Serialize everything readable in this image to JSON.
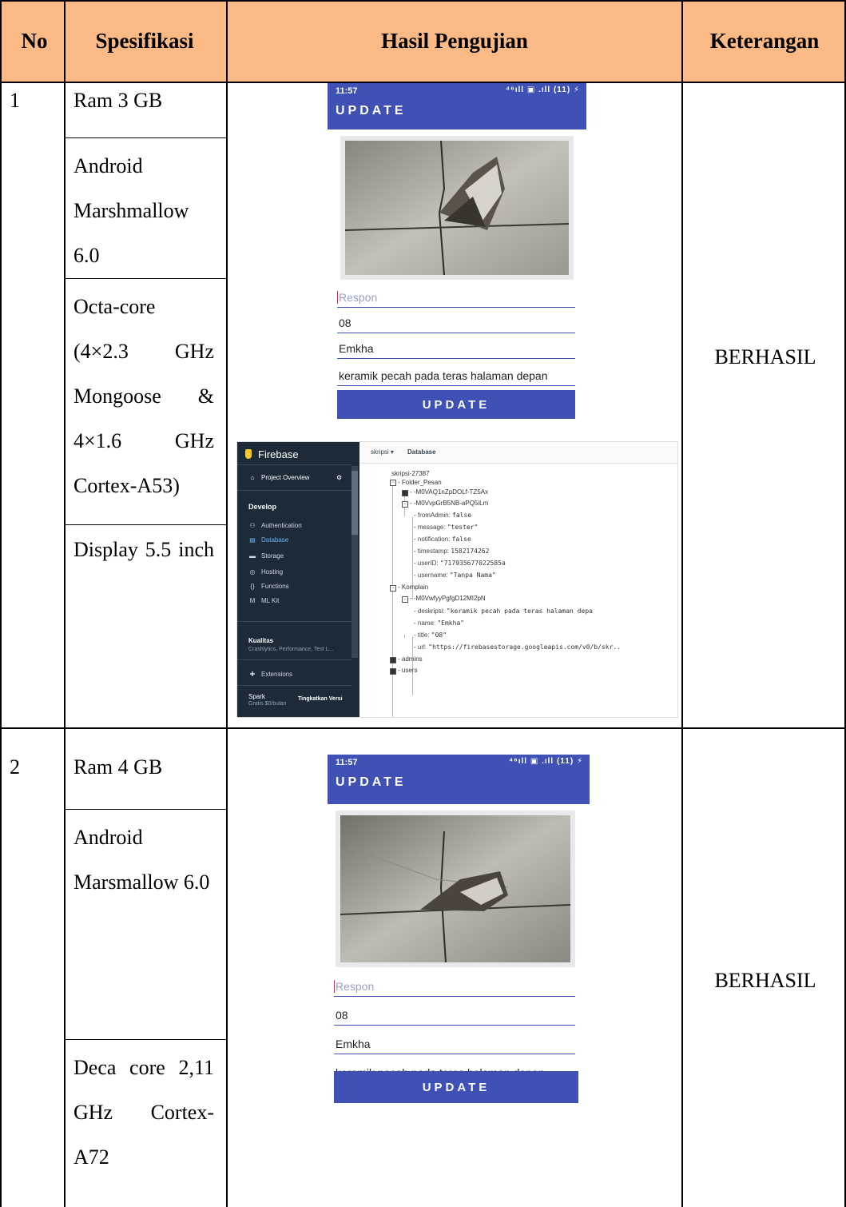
{
  "table": {
    "headers": [
      "No",
      "Spesifikasi",
      "Hasil Pengujian",
      "Keterangan"
    ],
    "rows": [
      {
        "no": "1",
        "specs": [
          "Ram 3 GB",
          "Android Marshmallow 6.0",
          "Octa-core (4×2.3 GHz Mongoose & 4×1.6 GHz Cortex-A53)",
          "Display 5.5 inch"
        ],
        "keterangan": "BERHASIL"
      },
      {
        "no": "2",
        "specs": [
          "Ram 4 GB",
          "Android Marsmallow 6.0",
          "Deca core 2,11 GHz Cortex-A72"
        ],
        "keterangan": "BERHASIL"
      }
    ]
  },
  "phone": {
    "time": "11:57",
    "status": "⁴⁶ıll ▣ .ıll (11) ⚡",
    "title": "UPDATE",
    "respon_placeholder": "Respon",
    "field_title": "08",
    "field_name": "Emkha",
    "field_desc": "keramik pecah pada teras halaman depan",
    "button": "UPDATE"
  },
  "firebase": {
    "brand": "Firebase",
    "project_overview": "Project Overview",
    "develop": "Develop",
    "nav": [
      "Authentication",
      "Database",
      "Storage",
      "Hosting",
      "Functions",
      "ML Kit"
    ],
    "kualitas": "Kualitas",
    "kualitas_sub": "Crashlytics, Performance, Test L...",
    "extensions": "Extensions",
    "plan": "Spark",
    "plan_sub": "Gratis $0/bulan",
    "upgrade": "Tingkatkan Versi",
    "breadcrumb_project": "skripsi",
    "breadcrumb_page": "Database",
    "root": "skripsi-27387",
    "folder_pesan": "Folder_Pesan",
    "pesan_1": "-M0VAQ1nZpDOLf-TZ5Ax",
    "pesan_2": "-M0VvpGrB5NB-aPQ5iLm",
    "pesan_fields": [
      {
        "k": "fromAdmin:",
        "v": "false"
      },
      {
        "k": "message:",
        "v": "\"tester\""
      },
      {
        "k": "notification:",
        "v": "false"
      },
      {
        "k": "timestamp:",
        "v": "1582174262"
      },
      {
        "k": "userID:",
        "v": "\"717935677022585a"
      },
      {
        "k": "username:",
        "v": "\"Tanpa Nama\""
      }
    ],
    "komplain": "Komplain",
    "komplain_1": "-M0VwfyyPgfgD12MI2pN",
    "komplain_fields": [
      {
        "k": "deskripsi:",
        "v": "\"keramik pecah pada teras halaman depa"
      },
      {
        "k": "name:",
        "v": "\"Emkha\""
      },
      {
        "k": "title:",
        "v": "\"08\""
      },
      {
        "k": "url:",
        "v": "\"https://firebasestorage.googleapis.com/v0/b/skr.."
      }
    ],
    "admins": "admins",
    "users": "users"
  }
}
